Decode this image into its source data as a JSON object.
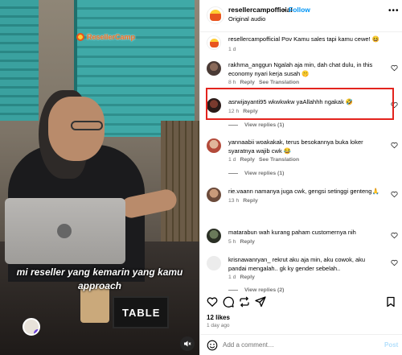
{
  "video": {
    "brand_overlay": "ResellerCamp",
    "caption_line1": "mi reseller yang kemarin yang kamu",
    "caption_line2": "approach",
    "sign_text": "TABLE"
  },
  "header": {
    "username": "resellercampofficial",
    "separator": "•",
    "follow_label": "Follow",
    "audio": "Original audio",
    "more": "•••"
  },
  "caption": {
    "username": "resellercampofficial",
    "text": "Pov Kamu sales tapi kamu cewe! 😆",
    "time": "1 d"
  },
  "comments": [
    {
      "username": "rakhma_anggun",
      "text": "Ngalah aja min, dah chat dulu, in this economy nyari kerja susah 🤫",
      "time": "8 h",
      "reply": "Reply",
      "translation": "See Translation"
    },
    {
      "username": "asrwijayanti95",
      "text": "wkwkwkw yaAllahhh ngakak 🤣",
      "time": "12 h",
      "reply": "Reply",
      "view_replies": "View replies (1)"
    },
    {
      "username": "yannaabii",
      "text": "woakakak, terus besokannya buka loker syaratnya wajib cwk 😂",
      "time": "1 d",
      "reply": "Reply",
      "translation": "See Translation",
      "view_replies": "View replies (1)"
    },
    {
      "username": "rie.vaann",
      "text": "namanya juga cwk, gengsi setinggi genteng🙏",
      "time": "13 h",
      "reply": "Reply"
    },
    {
      "username": "matarabun",
      "text": "wah kurang paham customernya nih",
      "time": "5 h",
      "reply": "Reply"
    },
    {
      "username": "krisnawanryan_",
      "text": "rekrut aku aja min, aku cowok, aku pandai mengalah.. gk ky gender sebelah..",
      "time": "1 d",
      "reply": "Reply",
      "view_replies": "View replies (2)"
    }
  ],
  "footer": {
    "likes": "12 likes",
    "ago": "1 day ago",
    "add_comment_placeholder": "Add a comment…",
    "post_label": "Post"
  },
  "colors": {
    "follow": "#0095f6",
    "highlight_border": "#e3241e",
    "brand_orange": "#f36f21"
  }
}
